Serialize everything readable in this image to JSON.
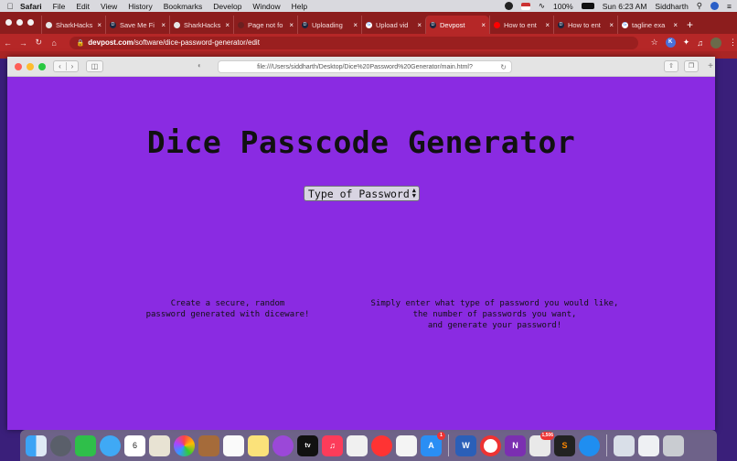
{
  "menubar": {
    "apple": "",
    "items": [
      "Safari",
      "File",
      "Edit",
      "View",
      "History",
      "Bookmarks",
      "Develop",
      "Window",
      "Help"
    ],
    "battery": "100%",
    "datetime": "Sun 6:23 AM",
    "user": "Siddharth"
  },
  "chrome": {
    "tabs": [
      {
        "label": "SharkHacks"
      },
      {
        "label": "Save Me Fi"
      },
      {
        "label": "SharkHacks"
      },
      {
        "label": "Page not fo"
      },
      {
        "label": "Uploading"
      },
      {
        "label": "Upload vid"
      },
      {
        "label": "Devpost"
      },
      {
        "label": "How to ent"
      },
      {
        "label": "How to ent"
      },
      {
        "label": "tagline exa"
      }
    ],
    "new_tab": "+",
    "url_host": "devpost.com",
    "url_path": "/software/dice-password-generator/edit",
    "extension_k": "K"
  },
  "safari": {
    "address": "file:///Users/siddharth/Desktop/Dice%20Password%20Generator/main.html?"
  },
  "page": {
    "title": "Dice Passcode Generator",
    "select_label": "Type of Password",
    "desc_left": "Create a secure, random\npassword generated with diceware!",
    "desc_right": "Simply enter what type of password you would like,\nthe number of passwords you want,\nand generate your password!"
  },
  "dock": {
    "calendar_day": "6",
    "appletv_label": "tv",
    "appstore_badge": "1",
    "word_label": "W",
    "onenote_label": "N",
    "onenote_badge": "1,506"
  },
  "colors": {
    "page_bg": "#8a2be2",
    "chrome_tab_bg": "#8c1d1d",
    "chrome_toolbar": "#b52727"
  }
}
